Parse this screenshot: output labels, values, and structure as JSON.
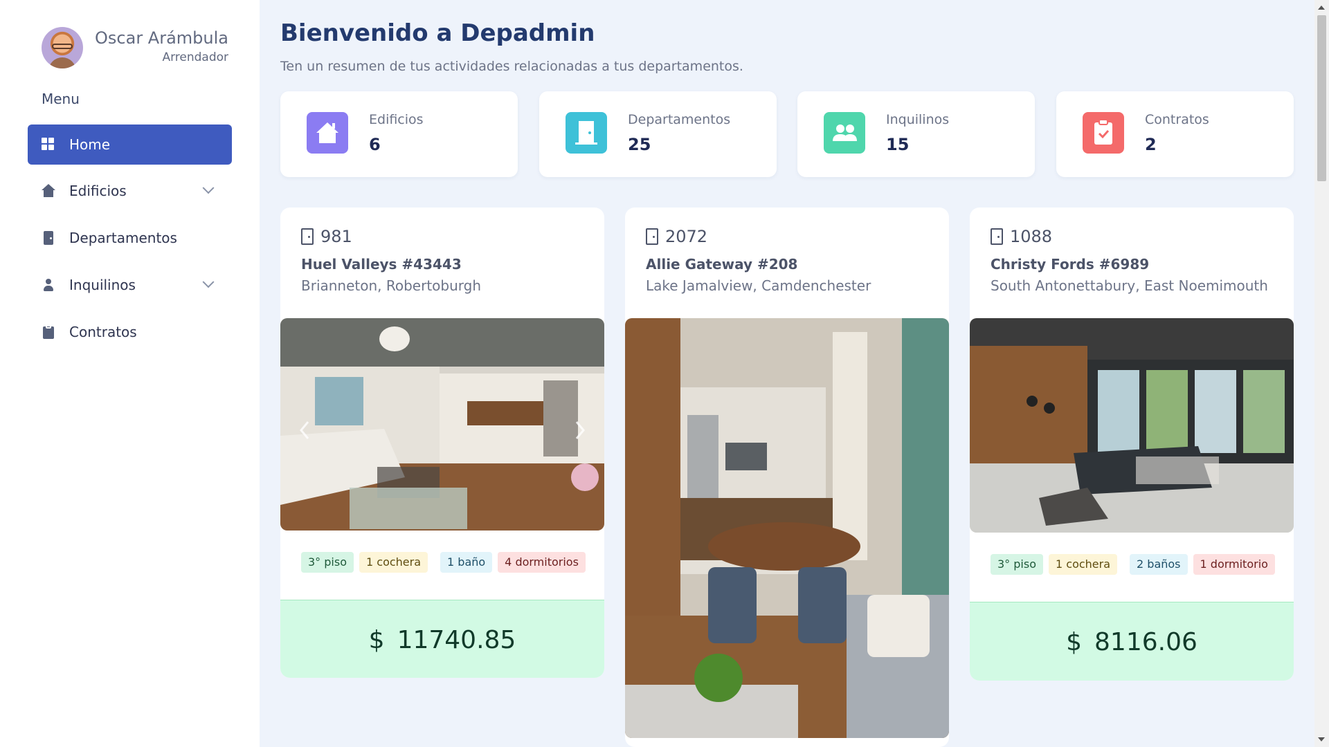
{
  "user": {
    "name": "Oscar Arámbula",
    "role": "Arrendador"
  },
  "sidebar": {
    "menu_title": "Menu",
    "items": [
      {
        "label": "Home"
      },
      {
        "label": "Edificios"
      },
      {
        "label": "Departamentos"
      },
      {
        "label": "Inquilinos"
      },
      {
        "label": "Contratos"
      }
    ]
  },
  "header": {
    "title": "Bienvenido a Depadmin",
    "subtitle": "Ten un resumen de tus actividades relacionadas a tus departamentos."
  },
  "stats": [
    {
      "label": "Edificios",
      "value": "6",
      "color": "#8b7cf2"
    },
    {
      "label": "Departamentos",
      "value": "25",
      "color": "#3ec1d8"
    },
    {
      "label": "Inquilinos",
      "value": "15",
      "color": "#4fd6ac"
    },
    {
      "label": "Contratos",
      "value": "2",
      "color": "#f46a6a"
    }
  ],
  "apartments": [
    {
      "number": "981",
      "address": "Huel Valleys #43443",
      "city": "Brianneton, Robertoburgh",
      "tags": {
        "floor": "3° piso",
        "garage": "1 cochera",
        "bath": "1 baño",
        "bedrooms": "4 dormitorios"
      },
      "currency": "$",
      "price": "11740.85"
    },
    {
      "number": "2072",
      "address": "Allie Gateway #208",
      "city": "Lake Jamalview, Camdenchester"
    },
    {
      "number": "1088",
      "address": "Christy Fords #6989",
      "city": "South Antonettabury, East Noemimouth",
      "tags": {
        "floor": "3° piso",
        "garage": "1 cochera",
        "bath": "2 baños",
        "bedrooms": "1 dormitorio"
      },
      "currency": "$",
      "price": "8116.06"
    }
  ]
}
